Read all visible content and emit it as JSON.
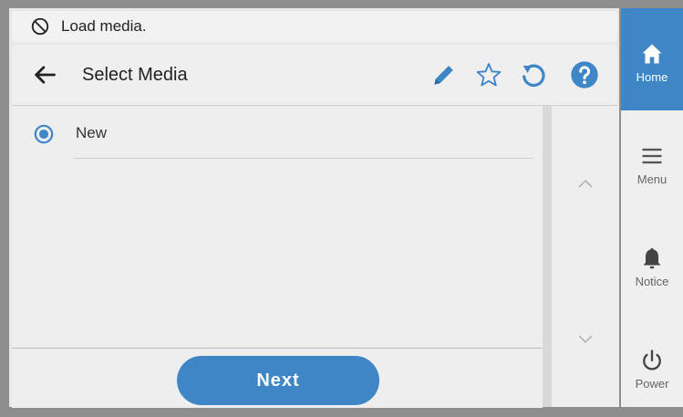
{
  "status": {
    "icon": "prohibited-icon",
    "message": "Load media."
  },
  "header": {
    "title": "Select Media",
    "back_icon": "arrow-left-icon",
    "actions": [
      "pencil-icon",
      "star-icon",
      "refresh-icon",
      "help-icon"
    ]
  },
  "media_list": {
    "items": [
      {
        "label": "New",
        "selected": true
      }
    ]
  },
  "footer": {
    "next_label": "Next"
  },
  "sidebar": {
    "items": [
      {
        "label": "Home",
        "icon": "home-icon",
        "active": true
      },
      {
        "label": "Menu",
        "icon": "menu-icon",
        "active": false
      },
      {
        "label": "Notice",
        "icon": "bell-icon",
        "active": false
      },
      {
        "label": "Power",
        "icon": "power-icon",
        "active": false
      }
    ]
  },
  "colors": {
    "accent": "#3f86c7",
    "panel": "#eeeeee",
    "background": "#e8e8e8"
  }
}
